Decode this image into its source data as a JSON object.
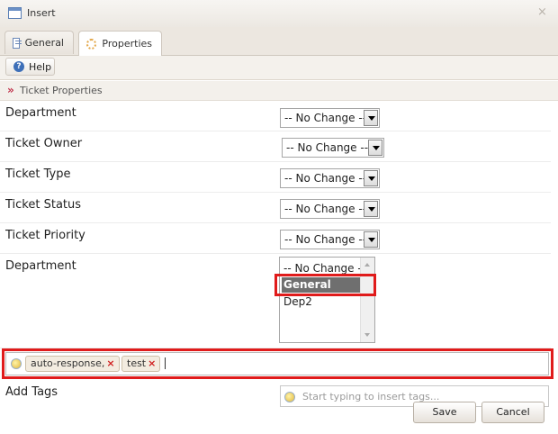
{
  "window": {
    "title": "Insert",
    "close_glyph": "×"
  },
  "tabs": [
    {
      "label": "General",
      "icon": "general-icon",
      "active": false
    },
    {
      "label": "Properties",
      "icon": "properties-icon",
      "active": true
    }
  ],
  "toolbar": {
    "help_label": "Help"
  },
  "section": {
    "title": "Ticket Properties",
    "marker": "»"
  },
  "fields": [
    {
      "label": "Department",
      "value": "-- No Change --"
    },
    {
      "label": "Ticket Owner",
      "value": "-- No Change --"
    },
    {
      "label": "Ticket Type",
      "value": "-- No Change --"
    },
    {
      "label": "Ticket Status",
      "value": "-- No Change --"
    },
    {
      "label": "Ticket Priority",
      "value": "-- No Change --"
    }
  ],
  "department_list": {
    "label": "Department",
    "options": [
      "-- No Change --",
      "General",
      "Dep2"
    ],
    "selected": "General"
  },
  "tags": {
    "chips": [
      "auto-response,",
      "test"
    ],
    "add_label": "Add Tags",
    "placeholder": "Start typing to insert tags..."
  },
  "buttons": {
    "save": "Save",
    "cancel": "Cancel"
  },
  "colors": {
    "highlight": "#e01b1b",
    "selected_bg": "#6f6f6f",
    "marker": "#c0304a"
  }
}
